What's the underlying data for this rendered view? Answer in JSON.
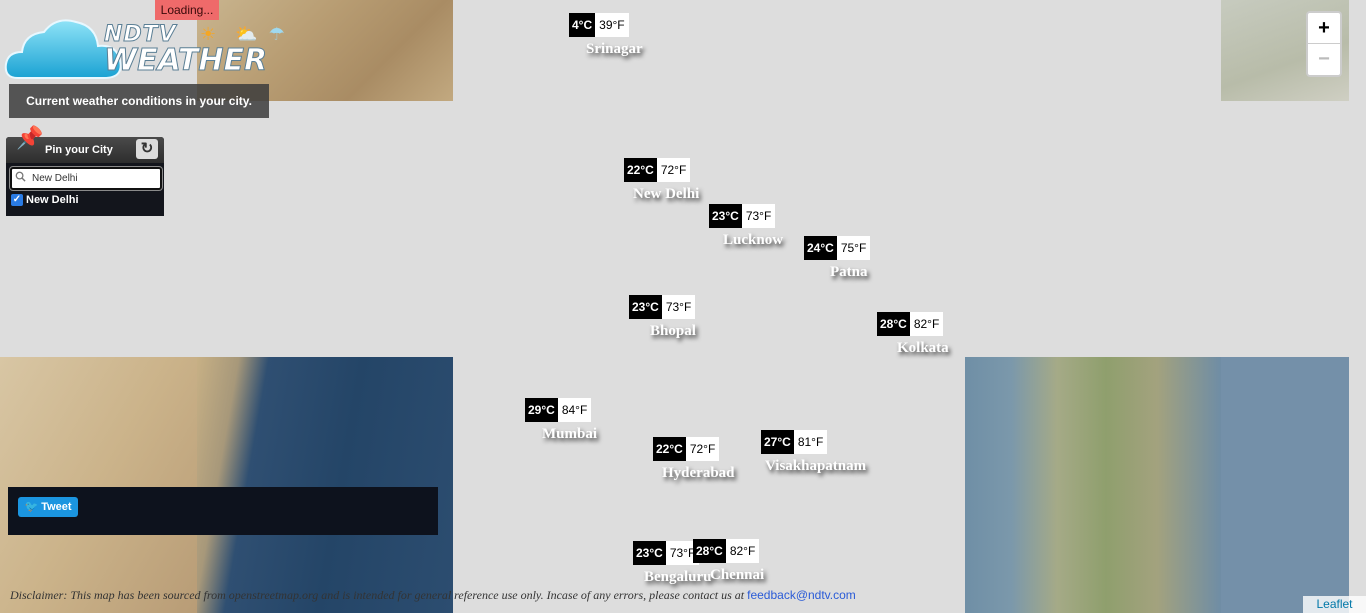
{
  "header": {
    "loading": "Loading...",
    "logo_ndtv": "NDTV",
    "logo_weather": "WEATHER",
    "subtitle": "Current weather conditions in your city."
  },
  "pin_panel": {
    "title": "Pin your City",
    "search_value": "New Delhi",
    "selected_city": "New Delhi"
  },
  "tweet": {
    "label": "Tweet"
  },
  "zoom": {
    "in": "+",
    "out": "−"
  },
  "cities": [
    {
      "name": "Srinagar",
      "c": "4°C",
      "f": "39°F"
    },
    {
      "name": "New Delhi",
      "c": "22°C",
      "f": "72°F"
    },
    {
      "name": "Lucknow",
      "c": "23°C",
      "f": "73°F"
    },
    {
      "name": "Patna",
      "c": "24°C",
      "f": "75°F"
    },
    {
      "name": "Bhopal",
      "c": "23°C",
      "f": "73°F"
    },
    {
      "name": "Kolkata",
      "c": "28°C",
      "f": "82°F"
    },
    {
      "name": "Mumbai",
      "c": "29°C",
      "f": "84°F"
    },
    {
      "name": "Hyderabad",
      "c": "22°C",
      "f": "72°F"
    },
    {
      "name": "Visakhapatnam",
      "c": "27°C",
      "f": "81°F"
    },
    {
      "name": "Bengaluru",
      "c": "23°C",
      "f": "73°F"
    },
    {
      "name": "Chennai",
      "c": "28°C",
      "f": "82°F"
    }
  ],
  "footer": {
    "disclaimer": "Disclaimer: This map has been sourced from openstreetmap.org and is intended for general reference use only. Incase of any errors, please contact us at ",
    "feedback_email": "feedback@ndtv.com",
    "attribution": "Leaflet"
  }
}
